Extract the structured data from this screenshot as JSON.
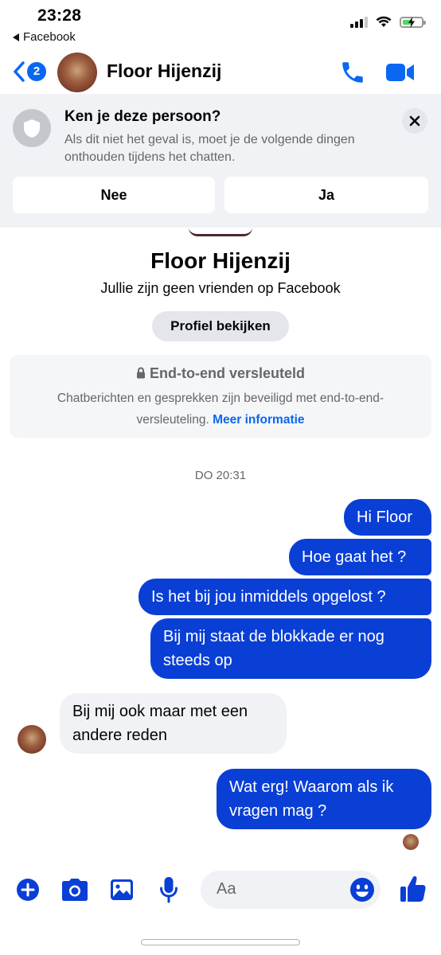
{
  "status_bar": {
    "time": "23:28",
    "back_app": "Facebook"
  },
  "header": {
    "unread_count": "2",
    "title": "Floor Hijenzij",
    "icons": [
      "chevron-left-icon",
      "phone-icon",
      "video-icon"
    ]
  },
  "banner": {
    "title": "Ken je deze persoon?",
    "text": "Als dit niet het geval is, moet je de volgende dingen onthouden tijdens het chatten.",
    "no_label": "Nee",
    "yes_label": "Ja"
  },
  "profile": {
    "name": "Floor Hijenzij",
    "subtitle": "Jullie zijn geen vrienden op Facebook",
    "view_profile_label": "Profiel bekijken"
  },
  "encryption": {
    "title": "End-to-end versleuteld",
    "text": "Chatberichten en gesprekken zijn beveiligd met end-to-end-versleuteling.",
    "link": "Meer informatie"
  },
  "timestamp": "DO 20:31",
  "messages": [
    {
      "from": "me",
      "text": "Hi Floor"
    },
    {
      "from": "me",
      "text": "Hoe gaat het ?"
    },
    {
      "from": "me",
      "text": "Is het bij jou inmiddels opgelost ?"
    },
    {
      "from": "me",
      "text": "Bij mij staat de blokkade er nog steeds op"
    },
    {
      "from": "them",
      "text": "Bij mij ook maar met een andere reden"
    },
    {
      "from": "me",
      "text": "Wat erg! Waarom als ik vragen mag ?"
    }
  ],
  "composer": {
    "placeholder": "Aa",
    "icons": [
      "plus-icon",
      "camera-icon",
      "image-icon",
      "microphone-icon",
      "emoji-icon",
      "thumbs-up-icon"
    ]
  },
  "colors": {
    "accent": "#0a67f2",
    "outgoing_bubble": "#0a3fd6",
    "incoming_bubble": "#f0f2f5"
  }
}
